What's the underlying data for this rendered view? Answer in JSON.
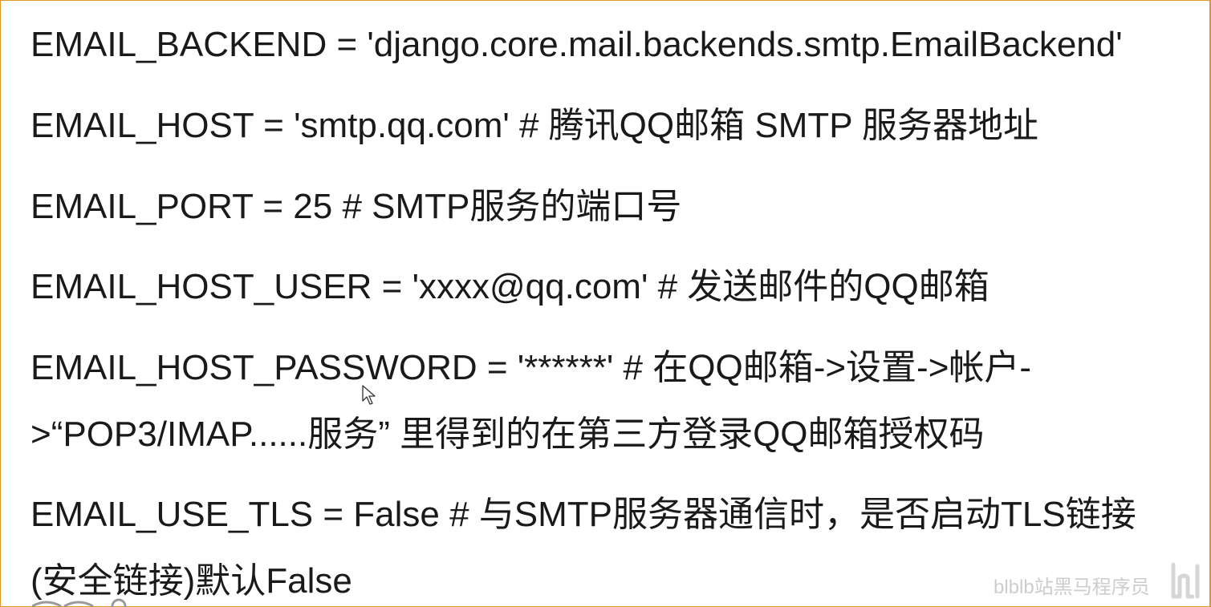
{
  "lines": [
    "EMAIL_BACKEND = 'django.core.mail.backends.smtp.EmailBackend'",
    "EMAIL_HOST = 'smtp.qq.com' # 腾讯QQ邮箱 SMTP 服务器地址",
    "EMAIL_PORT = 25  # SMTP服务的端口号",
    "EMAIL_HOST_USER = 'xxxx@qq.com'  # 发送邮件的QQ邮箱",
    "EMAIL_HOST_PASSWORD = '******'  # 在QQ邮箱->设置->帐户-",
    ">“POP3/IMAP......服务” 里得到的在第三方登录QQ邮箱授权码",
    "EMAIL_USE_TLS = False  # 与SMTP服务器通信时，是否启动TLS链接",
    "(安全链接)默认False"
  ],
  "watermark": "blblb站黑马程序员",
  "icons": {
    "cursor": "mouse-pointer-icon",
    "logo": "bilibili-logo-icon"
  },
  "colors": {
    "frame": "#e0962a",
    "text": "#1a1a1a",
    "watermark": "#bdbdbd"
  }
}
